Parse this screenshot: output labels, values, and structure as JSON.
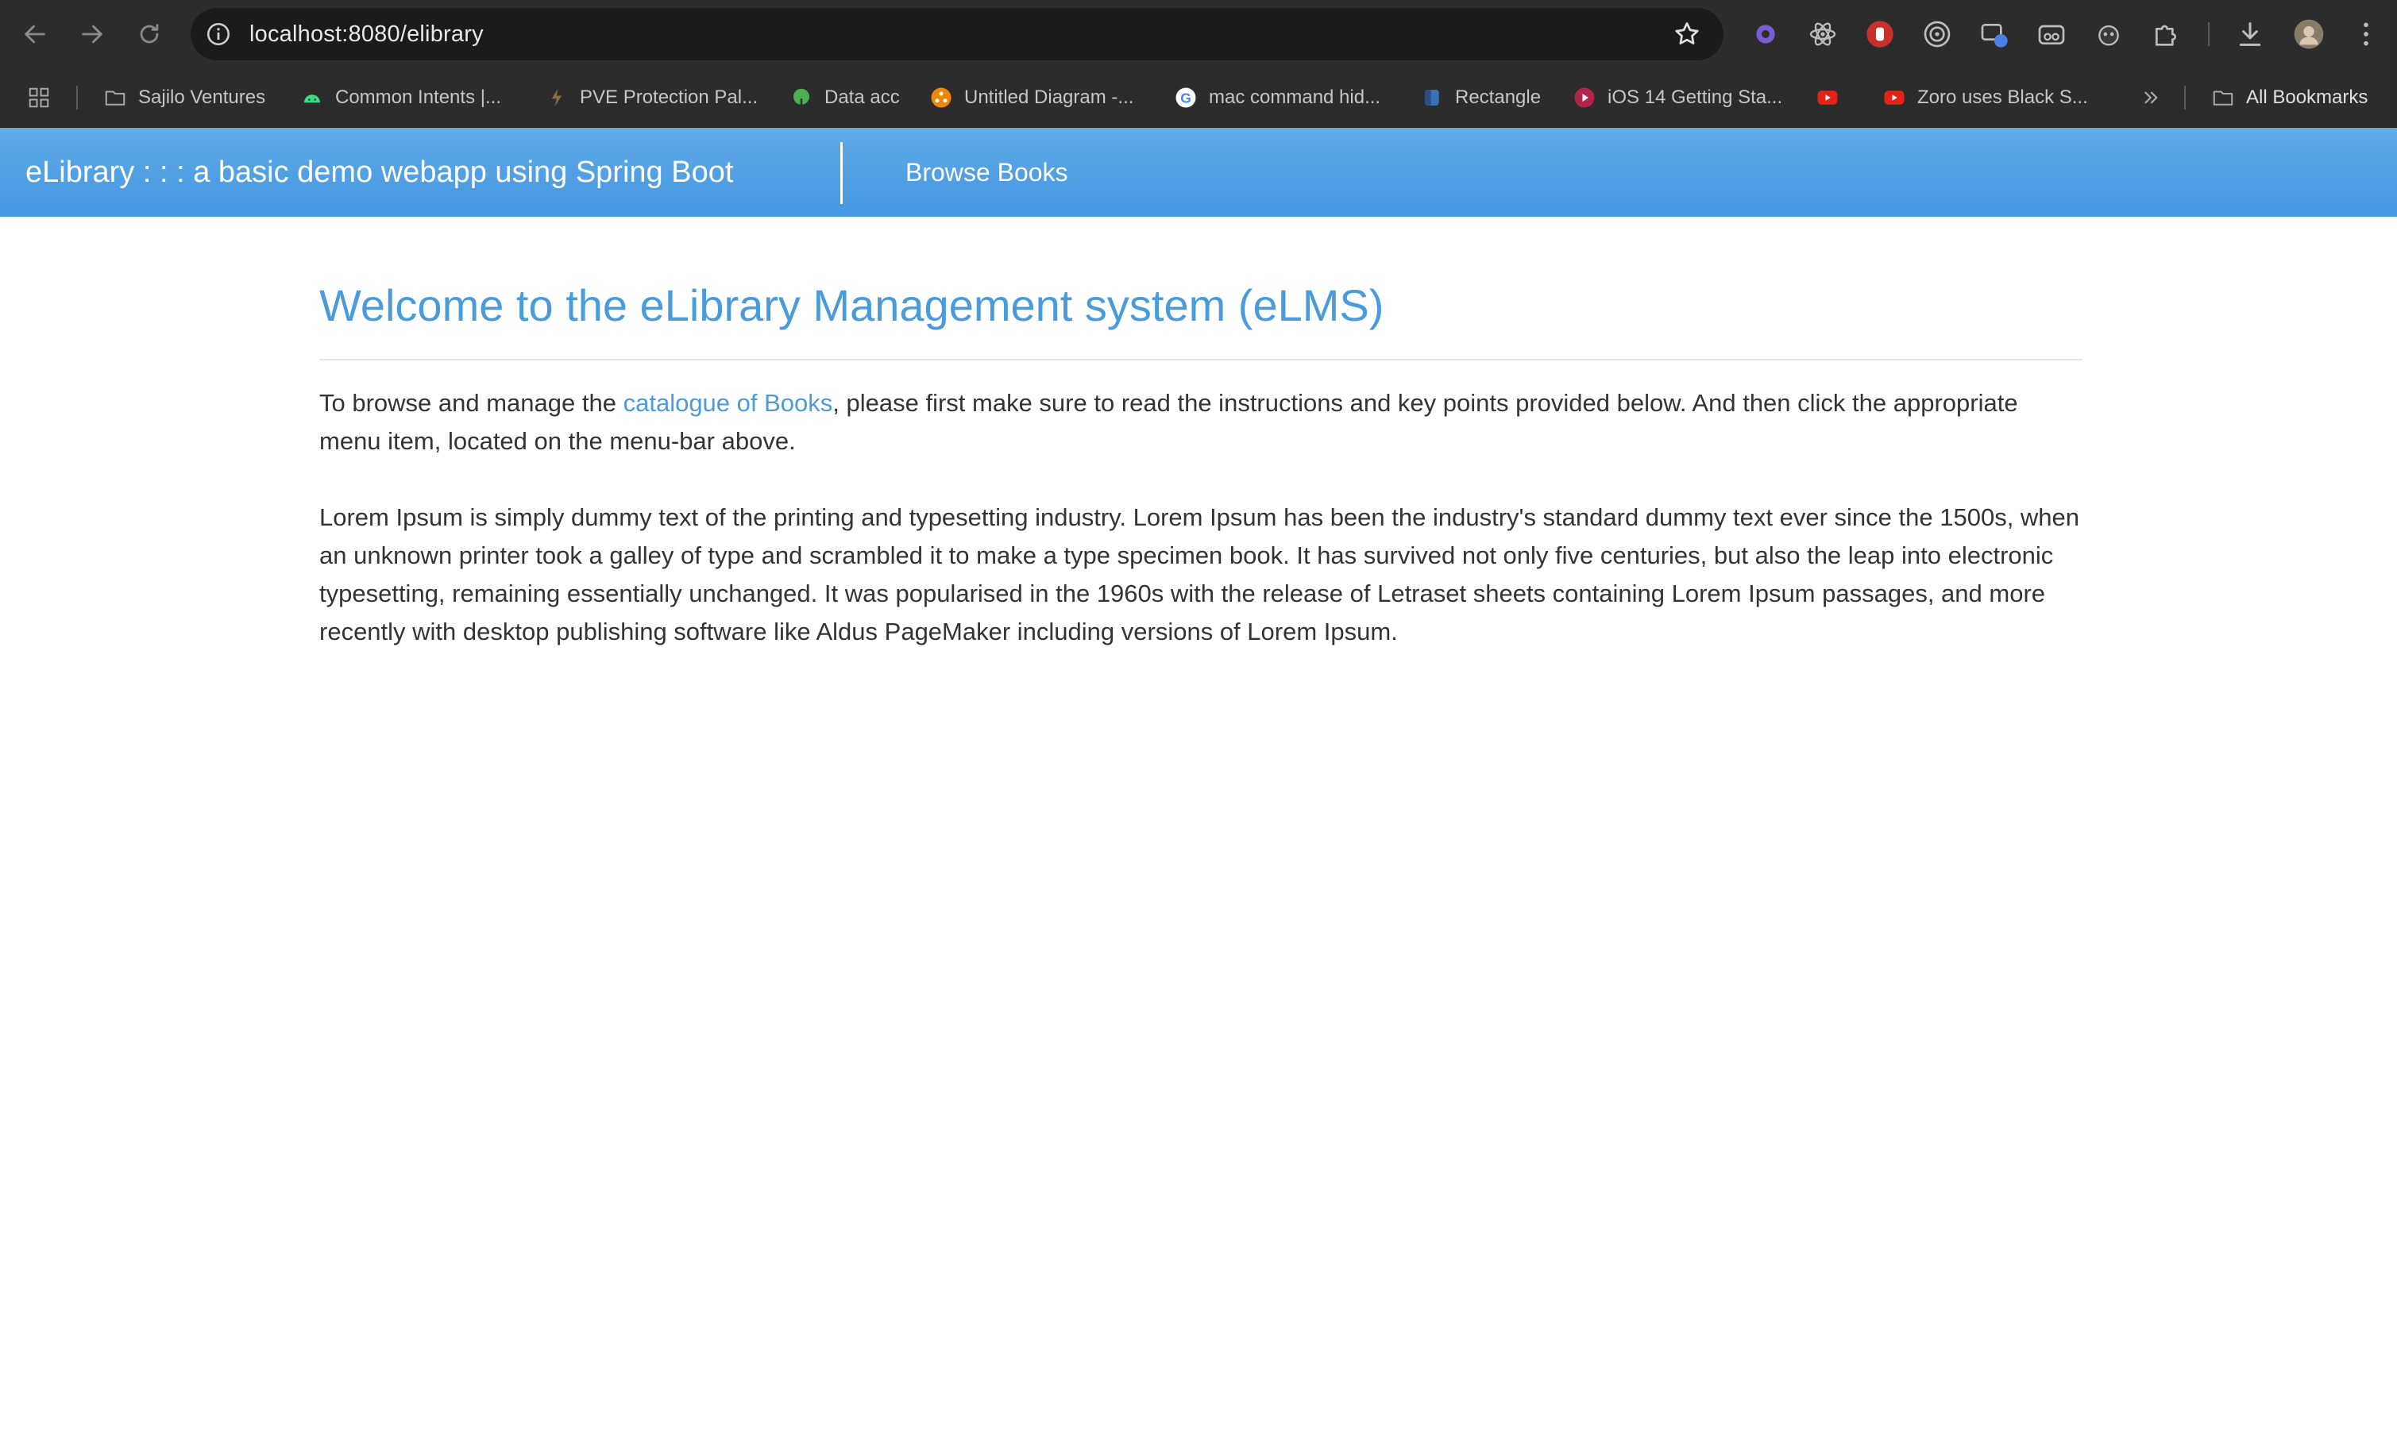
{
  "browser": {
    "url": "localhost:8080/elibrary",
    "bookmarks": [
      {
        "label": "Sajilo Ventures",
        "icon": "folder-icon"
      },
      {
        "label": "Common Intents |...",
        "icon": "android-icon"
      },
      {
        "label": "PVE Protection Pal...",
        "icon": "pve-icon"
      },
      {
        "label": "Data acc",
        "icon": "tree-icon"
      },
      {
        "label": "Untitled Diagram -...",
        "icon": "drawio-icon"
      },
      {
        "label": "mac command hid...",
        "icon": "google-icon"
      },
      {
        "label": "Rectangle",
        "icon": "rectangle-app-icon"
      },
      {
        "label": "iOS 14 Getting Sta...",
        "icon": "video-icon"
      },
      {
        "label": "",
        "icon": "youtube-icon"
      },
      {
        "label": "Zoro uses Black S...",
        "icon": "youtube-icon"
      }
    ],
    "all_bookmarks_label": "All Bookmarks"
  },
  "app": {
    "brand": "eLibrary : : : a basic demo webapp using Spring Boot",
    "nav_link": "Browse Books",
    "accent_color": "#4a9bdc"
  },
  "content": {
    "title": "Welcome to the eLibrary Management system (eLMS)",
    "intro_prefix": "To browse and manage the ",
    "intro_link": "catalogue of Books",
    "intro_suffix": ", please first make sure to read the instructions and key points provided below. And then click the appropriate menu item, located on the menu-bar above.",
    "lorem": "Lorem Ipsum is simply dummy text of the printing and typesetting industry. Lorem Ipsum has been the industry's standard dummy text ever since the 1500s, when an unknown printer took a galley of type and scrambled it to make a type specimen book. It has survived not only five centuries, but also the leap into electronic typesetting, remaining essentially unchanged. It was popularised in the 1960s with the release of Letraset sheets containing Lorem Ipsum passages, and more recently with desktop publishing software like Aldus PageMaker including versions of Lorem Ipsum."
  }
}
